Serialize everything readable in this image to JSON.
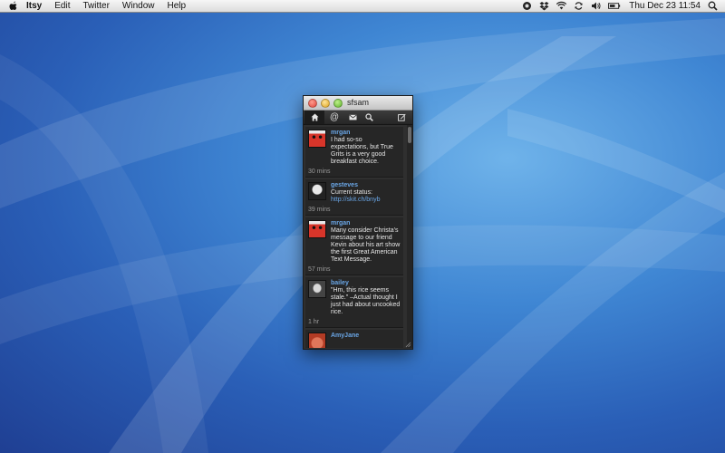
{
  "menubar": {
    "app": "Itsy",
    "items": [
      "Edit",
      "Twitter",
      "Window",
      "Help"
    ],
    "clock": "Thu Dec 23  11:54"
  },
  "window": {
    "title": "sfsam",
    "toolbar": [
      "home-icon",
      "mentions-icon",
      "messages-icon",
      "search-icon",
      "compose-icon"
    ]
  },
  "tweets": [
    {
      "user": "mrgan",
      "text": "I had so-so expectations, but True Grits is a very good breakfast choice.",
      "time": "30 mins"
    },
    {
      "user": "gesteves",
      "text_prefix": "Current status: ",
      "link": "http://skit.ch/bnyb",
      "time": "39 mins"
    },
    {
      "user": "mrgan",
      "text": "Many consider Christa's message to our friend Kevin about his art show the first Great American Text Message.",
      "time": "57 mins"
    },
    {
      "user": "bailey",
      "text": "\"Hm, this rice seems stale.\" –Actual thought I just had about uncooked rice.",
      "time": "1 hr"
    },
    {
      "user": "AmyJane",
      "text": "",
      "time": ""
    }
  ]
}
